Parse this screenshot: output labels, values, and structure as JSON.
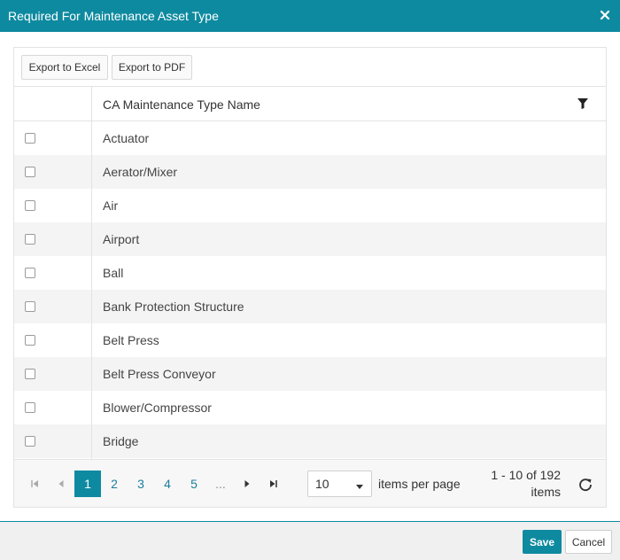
{
  "dialog": {
    "title": "Required For Maintenance Asset Type"
  },
  "toolbar": {
    "export_excel_label": "Export to Excel",
    "export_pdf_label": "Export to PDF"
  },
  "grid": {
    "column_header": "CA Maintenance Type Name",
    "rows": [
      {
        "name": "Actuator",
        "checked": false
      },
      {
        "name": "Aerator/Mixer",
        "checked": false
      },
      {
        "name": "Air",
        "checked": false
      },
      {
        "name": "Airport",
        "checked": false
      },
      {
        "name": "Ball",
        "checked": false
      },
      {
        "name": "Bank Protection Structure",
        "checked": false
      },
      {
        "name": "Belt Press",
        "checked": false
      },
      {
        "name": "Belt Press Conveyor",
        "checked": false
      },
      {
        "name": "Blower/Compressor",
        "checked": false
      },
      {
        "name": "Bridge",
        "checked": false
      }
    ]
  },
  "pager": {
    "pages": [
      "1",
      "2",
      "3",
      "4",
      "5"
    ],
    "current_page": "1",
    "ellipsis": "...",
    "page_size": "10",
    "items_per_page_label": "items per page",
    "info_line1": "1 - 10 of 192",
    "info_line2": "items"
  },
  "footer": {
    "save_label": "Save",
    "cancel_label": "Cancel"
  },
  "colors": {
    "accent": "#0E8AA0"
  }
}
